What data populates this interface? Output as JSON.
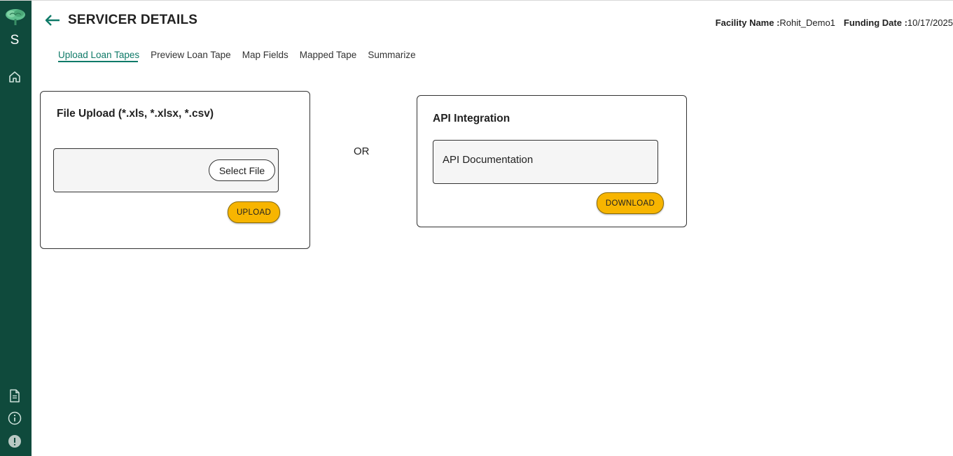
{
  "sidebar": {
    "logo_icon": "brain-tree-logo",
    "user_initial": "S",
    "icons": [
      "home-icon",
      "document-icon",
      "info-icon",
      "alert-icon"
    ]
  },
  "header": {
    "title": "SERVICER DETAILS",
    "facility_label": "Facility Name :",
    "facility_value": "Rohit_Demo1",
    "funding_label": "Funding Date :",
    "funding_value": "10/17/2025"
  },
  "tabs": [
    {
      "label": "Upload Loan Tapes",
      "active": true
    },
    {
      "label": "Preview Loan Tape",
      "active": false
    },
    {
      "label": "Map Fields",
      "active": false
    },
    {
      "label": "Mapped Tape",
      "active": false
    },
    {
      "label": "Summarize",
      "active": false
    }
  ],
  "file_upload": {
    "title": "File Upload (*.xls, *.xlsx, *.csv)",
    "select_label": "Select File",
    "upload_label": "UPLOAD"
  },
  "separator": "OR",
  "api": {
    "title": "API Integration",
    "doc_label": "API Documentation",
    "download_label": "DOWNLOAD"
  },
  "colors": {
    "sidebar": "#0f4a3c",
    "accent": "#0f7a68",
    "button_yellow": "#f7b500"
  }
}
